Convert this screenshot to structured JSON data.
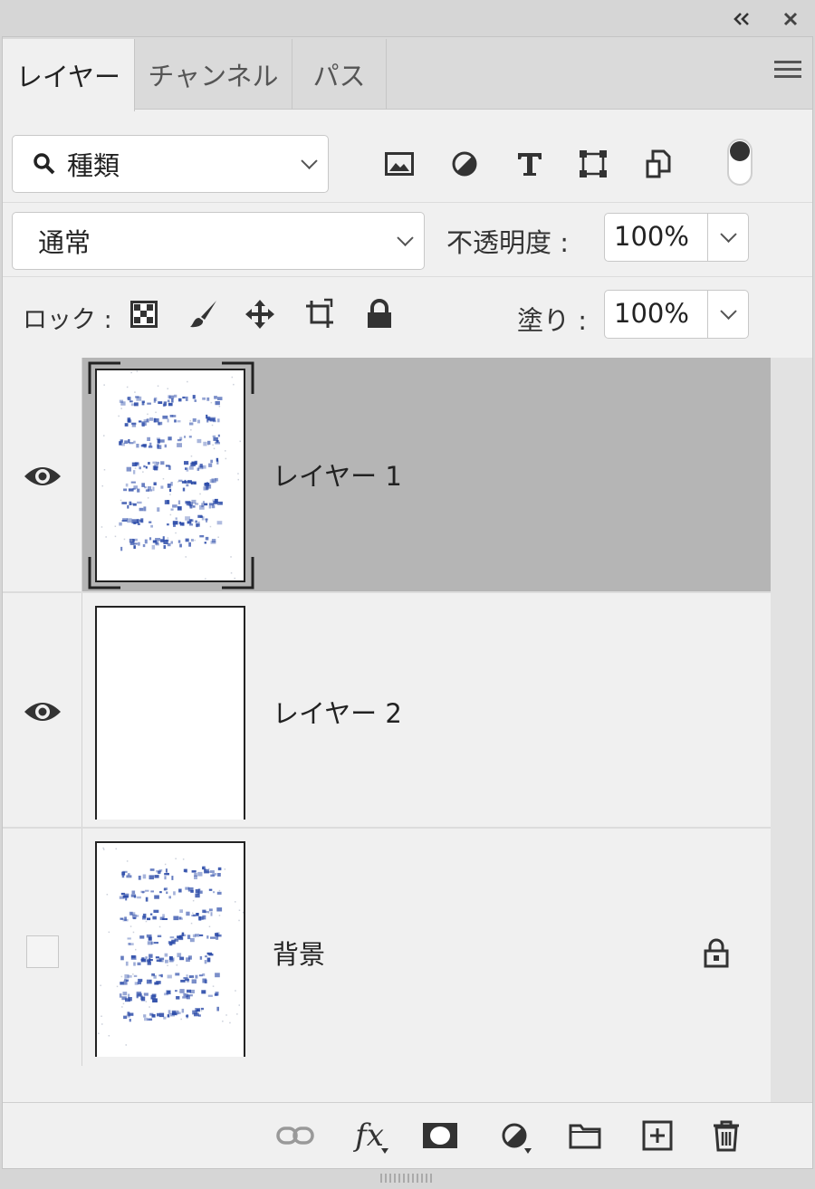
{
  "tabs": [
    {
      "label": "レイヤー",
      "active": true
    },
    {
      "label": "チャンネル",
      "active": false
    },
    {
      "label": "パス",
      "active": false
    }
  ],
  "filter": {
    "kind_label": "種類",
    "icons": [
      "image-filter-icon",
      "adjustment-filter-icon",
      "type-filter-icon",
      "shape-filter-icon",
      "smart-object-filter-icon",
      "filter-toggle-icon"
    ]
  },
  "blend": {
    "mode": "通常",
    "opacity_label": "不透明度 :",
    "opacity_value": "100%"
  },
  "lock": {
    "label": "ロック :",
    "icons": [
      "lock-transparent-icon",
      "lock-image-icon",
      "lock-position-icon",
      "lock-artboard-icon",
      "lock-all-icon"
    ],
    "fill_label": "塗り :",
    "fill_value": "100%"
  },
  "layers": [
    {
      "name": "レイヤー 1",
      "visible": true,
      "selected": true,
      "thumbnail": "document",
      "locked": false
    },
    {
      "name": "レイヤー 2",
      "visible": true,
      "selected": false,
      "thumbnail": "blank",
      "locked": false
    },
    {
      "name": "背景",
      "visible": false,
      "selected": false,
      "thumbnail": "document",
      "locked": true
    }
  ],
  "bottom_icons": [
    "link-layers-icon",
    "layer-style-icon",
    "add-mask-icon",
    "new-adjustment-icon",
    "new-group-icon",
    "new-layer-icon",
    "delete-layer-icon"
  ],
  "bottom_labels": {
    "fx": "fx"
  },
  "colors": {
    "panel_bg": "#f0f0f0",
    "selected_row": "#b5b5b5",
    "doc_ink": "#2a4aa8"
  }
}
